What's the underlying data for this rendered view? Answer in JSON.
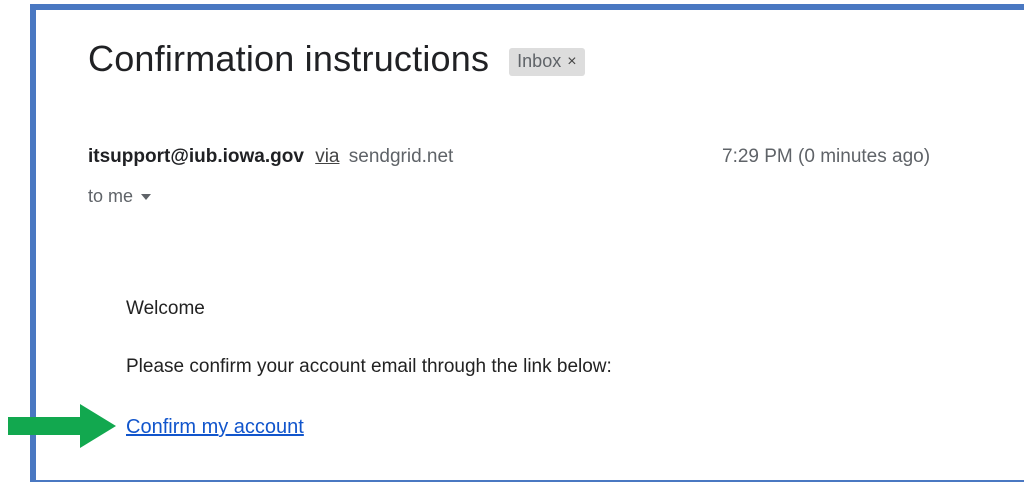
{
  "email": {
    "subject": "Confirmation instructions",
    "label": "Inbox",
    "label_close": "×",
    "sender": "itsupport@iub.iowa.gov",
    "via_label": "via",
    "via_domain": "sendgrid.net",
    "timestamp": "7:29 PM (0 minutes ago)",
    "recipient": "to me"
  },
  "body": {
    "greeting": "Welcome",
    "instruction": "Please confirm your account email through the link below:",
    "link_text": "Confirm my account"
  },
  "colors": {
    "frame_border": "#4a78c2",
    "arrow": "#12a84f",
    "link": "#1155cc"
  }
}
